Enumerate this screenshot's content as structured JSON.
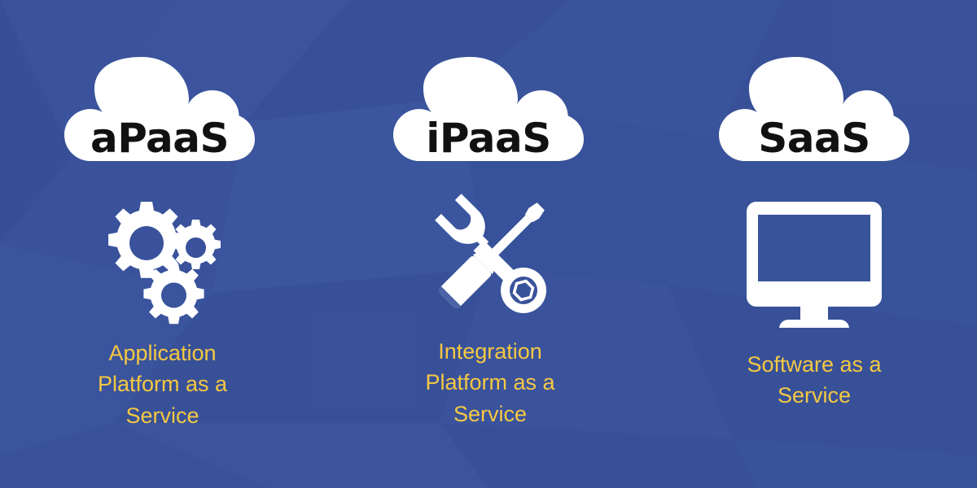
{
  "background": {
    "color": "#39539b",
    "poly_light": "#41599f",
    "poly_dark": "#344d94"
  },
  "theme": {
    "cloud_fill": "#ffffff",
    "cloud_label_color": "#111111",
    "icon_color": "#ffffff",
    "caption_color": "#f5c842"
  },
  "columns": [
    {
      "id": "apaas",
      "cloud_label": "aPaaS",
      "icon_name": "gears-icon",
      "caption": "Application Platform as a Service"
    },
    {
      "id": "ipaas",
      "cloud_label": "iPaaS",
      "icon_name": "wrench-screwdriver-icon",
      "caption": "Integration Platform as a Service"
    },
    {
      "id": "saas",
      "cloud_label": "SaaS",
      "icon_name": "monitor-icon",
      "caption": "Software as a Service"
    }
  ]
}
